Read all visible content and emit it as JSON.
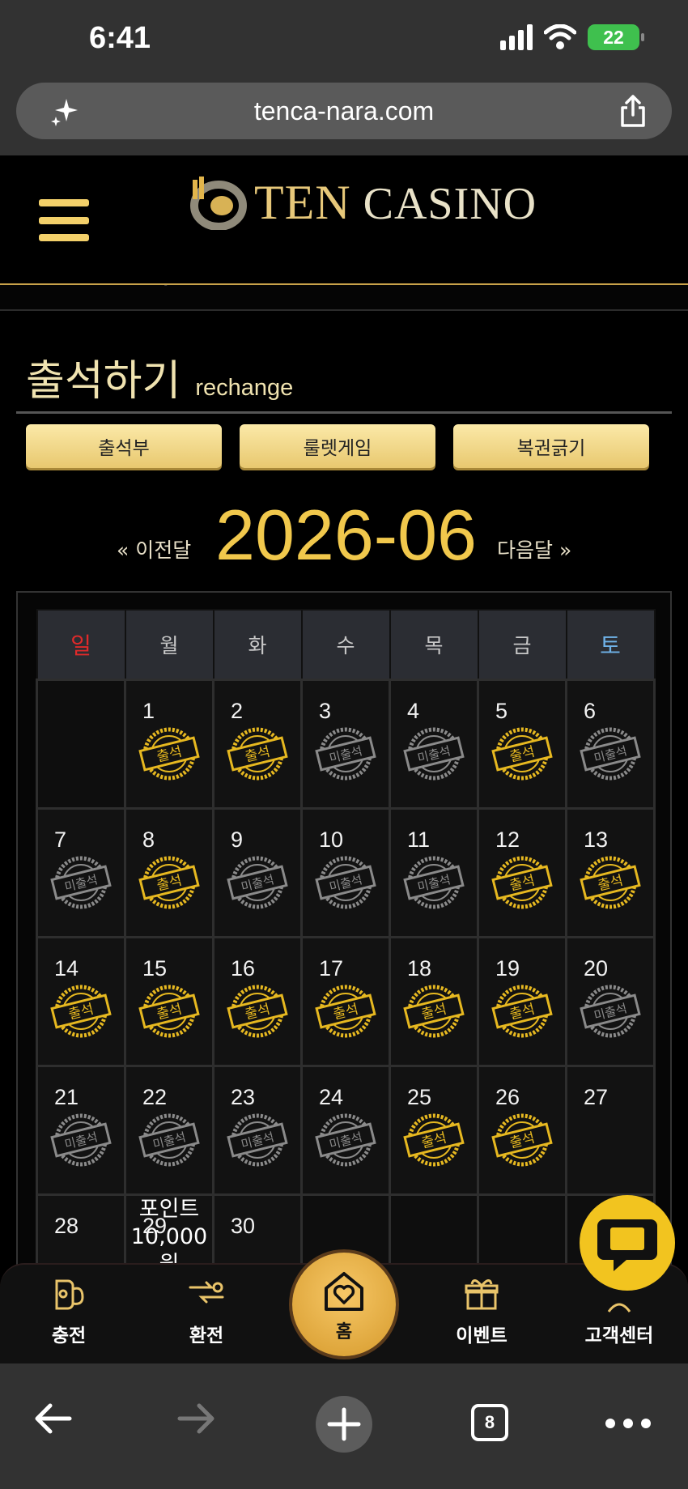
{
  "status_bar": {
    "time": "6:41",
    "battery": "22"
  },
  "browser": {
    "url": "tenca-nara.com",
    "tab_count": "8"
  },
  "header": {
    "logo_text_1": "TEN",
    "logo_text_2": "CASINO"
  },
  "page": {
    "title_ko": "출석하기",
    "title_en": "rechange",
    "tabs": [
      "출석부",
      "룰렛게임",
      "복권긁기"
    ]
  },
  "month": {
    "prev": "« 이전달",
    "current": "2026-06",
    "next": "다음달 »"
  },
  "calendar": {
    "weekdays": [
      "일",
      "월",
      "화",
      "수",
      "목",
      "금",
      "토"
    ],
    "attended_label": "출석",
    "missed_label": "미출석",
    "reward_text": "포인트 10,000 원",
    "days": [
      {
        "day": "1",
        "status": "attended"
      },
      {
        "day": "2",
        "status": "attended"
      },
      {
        "day": "3",
        "status": "missed"
      },
      {
        "day": "4",
        "status": "missed"
      },
      {
        "day": "5",
        "status": "attended"
      },
      {
        "day": "6",
        "status": "missed"
      },
      {
        "day": "7",
        "status": "missed"
      },
      {
        "day": "8",
        "status": "attended"
      },
      {
        "day": "9",
        "status": "missed"
      },
      {
        "day": "10",
        "status": "missed"
      },
      {
        "day": "11",
        "status": "missed"
      },
      {
        "day": "12",
        "status": "attended"
      },
      {
        "day": "13",
        "status": "attended"
      },
      {
        "day": "14",
        "status": "attended"
      },
      {
        "day": "15",
        "status": "attended"
      },
      {
        "day": "16",
        "status": "attended"
      },
      {
        "day": "17",
        "status": "attended"
      },
      {
        "day": "18",
        "status": "attended"
      },
      {
        "day": "19",
        "status": "attended"
      },
      {
        "day": "20",
        "status": "missed"
      },
      {
        "day": "21",
        "status": "missed"
      },
      {
        "day": "22",
        "status": "missed"
      },
      {
        "day": "23",
        "status": "missed"
      },
      {
        "day": "24",
        "status": "missed"
      },
      {
        "day": "25",
        "status": "attended"
      },
      {
        "day": "26",
        "status": "attended"
      },
      {
        "day": "27",
        "status": "none"
      },
      {
        "day": "28",
        "status": "none"
      },
      {
        "day": "29",
        "status": "reward"
      },
      {
        "day": "30",
        "status": "none"
      }
    ],
    "leading_empty": 1,
    "trailing_empty": 4
  },
  "bottom_nav": {
    "items": [
      {
        "label": "충전",
        "icon": "charge-icon"
      },
      {
        "label": "환전",
        "icon": "exchange-icon"
      },
      {
        "label": "홈",
        "icon": "home-heart-icon"
      },
      {
        "label": "이벤트",
        "icon": "gift-icon"
      },
      {
        "label": "고객센터",
        "icon": "support-icon"
      }
    ]
  },
  "colors": {
    "gold": "#f1c84c",
    "stamp_gold": "#e6b820",
    "stamp_gray": "#8a8a8a",
    "sunday": "#e02a2a",
    "saturday": "#6fb2e8"
  }
}
